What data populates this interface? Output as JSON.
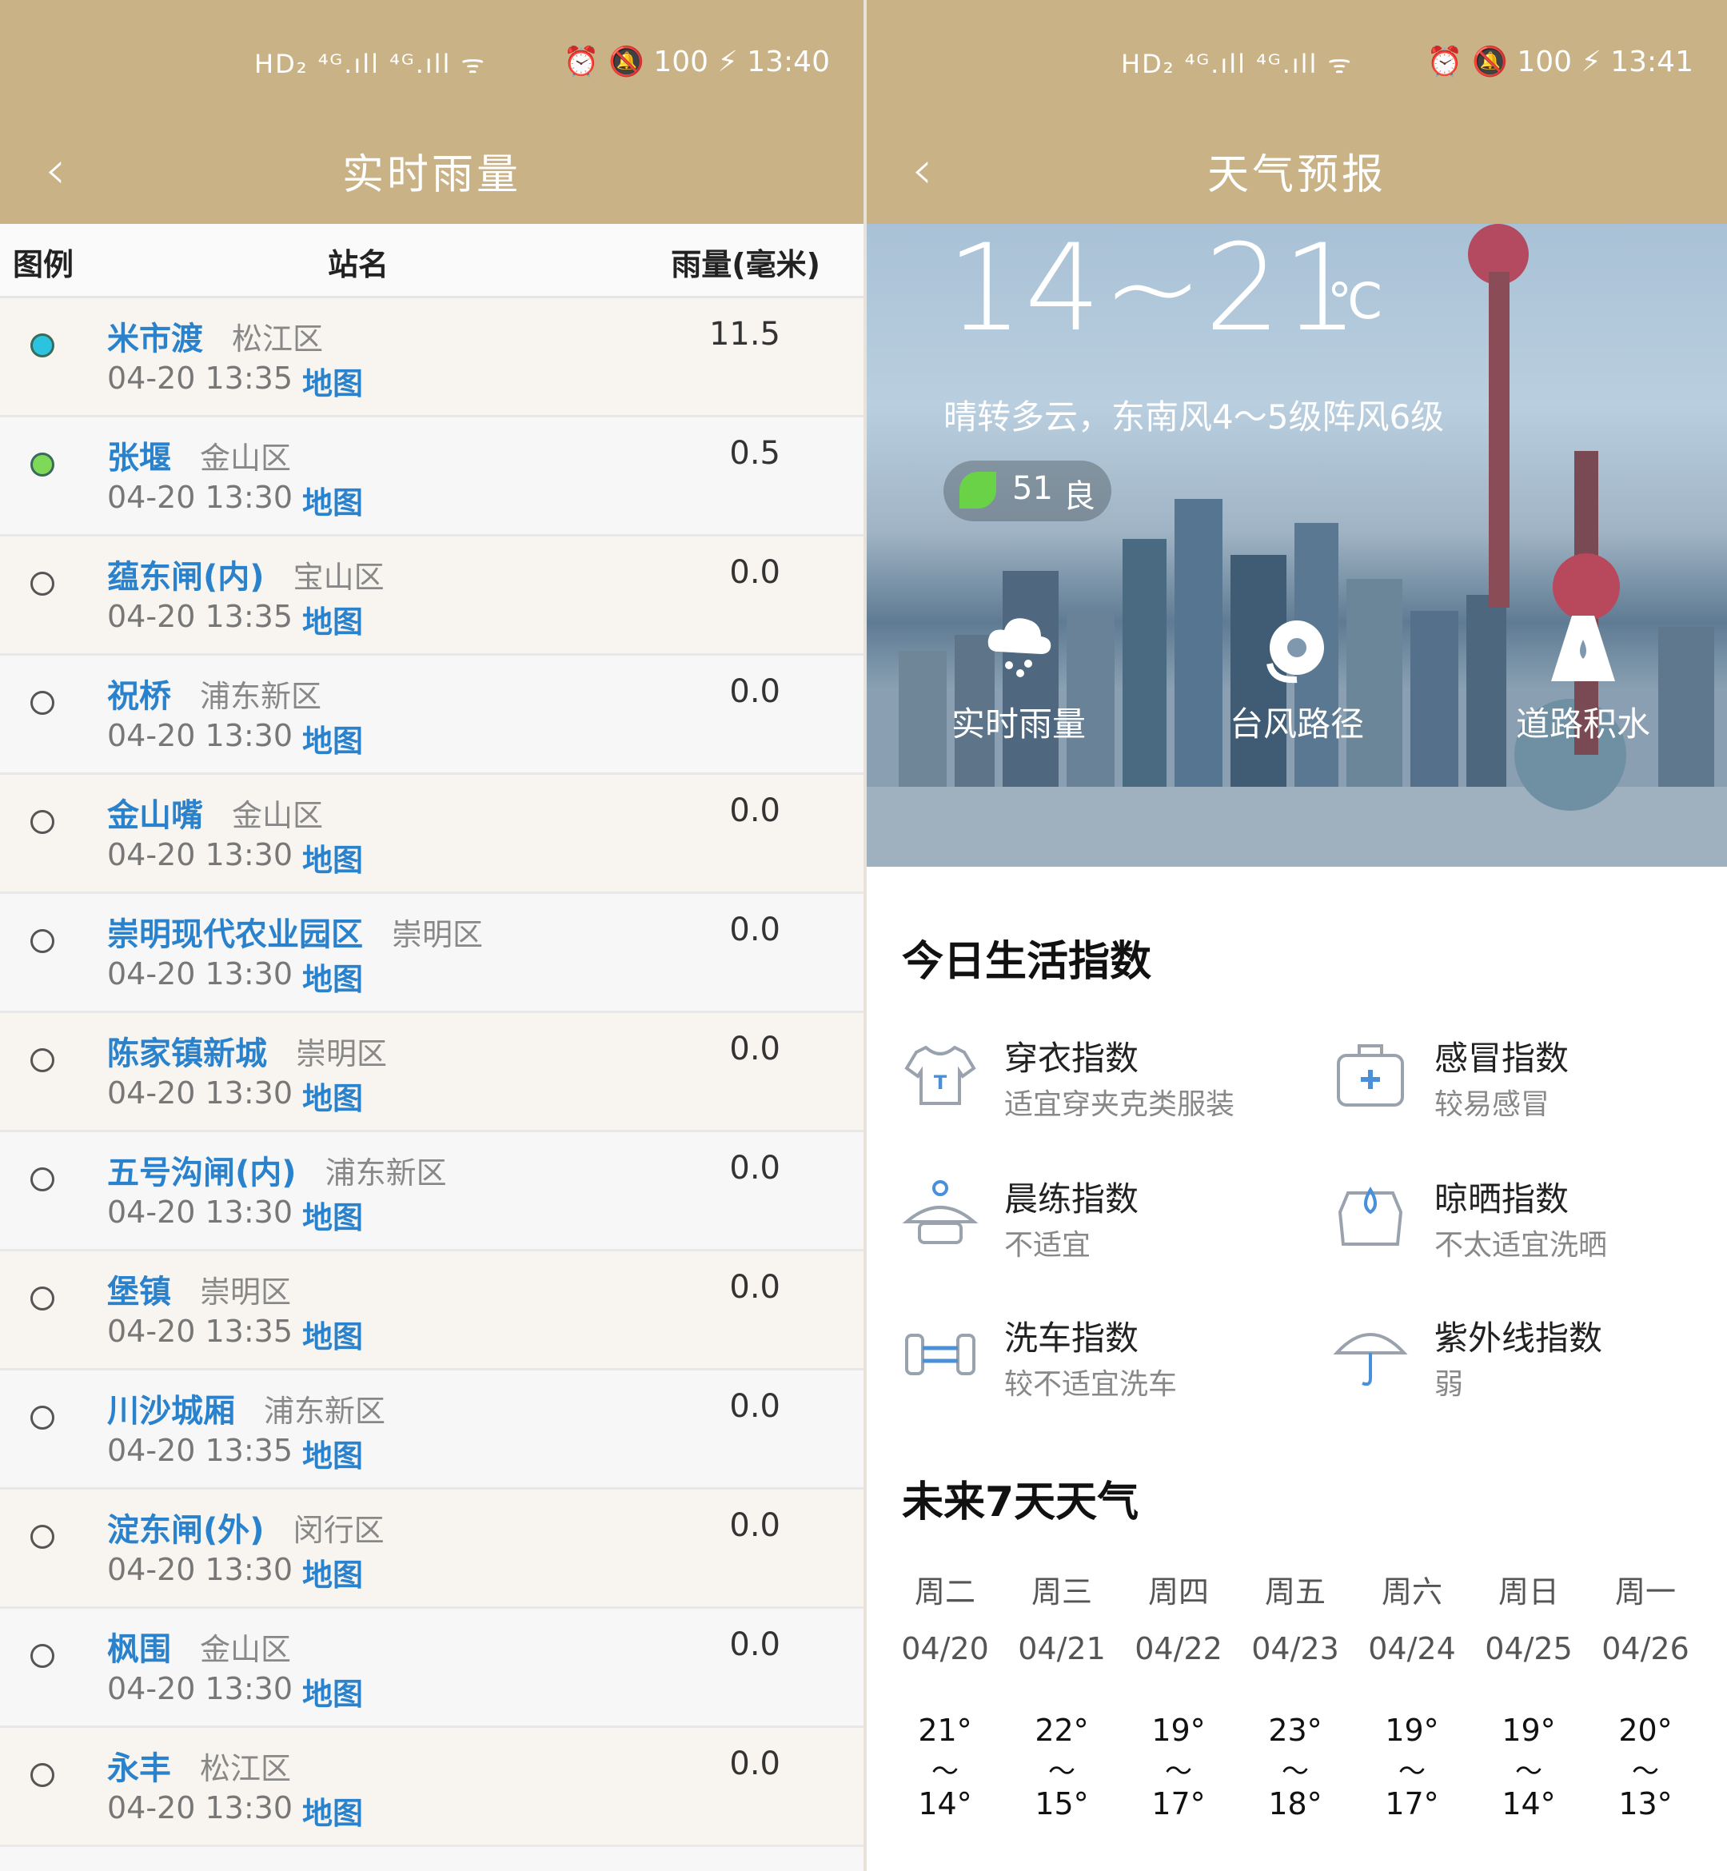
{
  "left": {
    "status": {
      "left": "HD₂ ⁴ᴳ.ıll ⁴ᴳ.ıll ᯤ",
      "right": "⏰ 🔕 100 ⚡ 13:40"
    },
    "title": "实时雨量",
    "table_headers": {
      "legend": "图例",
      "station": "站名",
      "rain": "雨量(毫米)"
    },
    "map_label": "地图",
    "rows": [
      {
        "name": "米市渡",
        "district": "松江区",
        "time": "04-20 13:35",
        "rain": "11.5",
        "dot": "#2bc3e0"
      },
      {
        "name": "张堰",
        "district": "金山区",
        "time": "04-20 13:30",
        "rain": "0.5",
        "dot": "#7ed957"
      },
      {
        "name": "蕴东闸(内)",
        "district": "宝山区",
        "time": "04-20 13:35",
        "rain": "0.0",
        "dot": ""
      },
      {
        "name": "祝桥",
        "district": "浦东新区",
        "time": "04-20 13:30",
        "rain": "0.0",
        "dot": ""
      },
      {
        "name": "金山嘴",
        "district": "金山区",
        "time": "04-20 13:30",
        "rain": "0.0",
        "dot": ""
      },
      {
        "name": "崇明现代农业园区",
        "district": "崇明区",
        "time": "04-20 13:30",
        "rain": "0.0",
        "dot": ""
      },
      {
        "name": "陈家镇新城",
        "district": "崇明区",
        "time": "04-20 13:30",
        "rain": "0.0",
        "dot": ""
      },
      {
        "name": "五号沟闸(内)",
        "district": "浦东新区",
        "time": "04-20 13:30",
        "rain": "0.0",
        "dot": ""
      },
      {
        "name": "堡镇",
        "district": "崇明区",
        "time": "04-20 13:35",
        "rain": "0.0",
        "dot": ""
      },
      {
        "name": "川沙城厢",
        "district": "浦东新区",
        "time": "04-20 13:35",
        "rain": "0.0",
        "dot": ""
      },
      {
        "name": "淀东闸(外)",
        "district": "闵行区",
        "time": "04-20 13:30",
        "rain": "0.0",
        "dot": ""
      },
      {
        "name": "枫围",
        "district": "金山区",
        "time": "04-20 13:30",
        "rain": "0.0",
        "dot": ""
      },
      {
        "name": "永丰",
        "district": "松江区",
        "time": "04-20 13:30",
        "rain": "0.0",
        "dot": ""
      }
    ]
  },
  "right": {
    "status": {
      "left": "HD₂ ⁴ᴳ.ıll ⁴ᴳ.ıll ᯤ",
      "right": "⏰ 🔕 100 ⚡ 13:41"
    },
    "title": "天气预报",
    "temp_range": "14~21",
    "temp_unit": "℃",
    "description": "晴转多云，东南风4～5级阵风6级",
    "aqi": {
      "value": "51",
      "level": "良"
    },
    "shortcuts": [
      "实时雨量",
      "台风路径",
      "道路积水"
    ],
    "life_title": "今日生活指数",
    "life_index": [
      {
        "title": "穿衣指数",
        "sub": "适宜穿夹克类服装",
        "icon": "shirt-icon"
      },
      {
        "title": "感冒指数",
        "sub": "较易感冒",
        "icon": "medkit-icon"
      },
      {
        "title": "晨练指数",
        "sub": "不适宜",
        "icon": "exercise-icon"
      },
      {
        "title": "晾晒指数",
        "sub": "不太适宜洗晒",
        "icon": "laundry-icon"
      },
      {
        "title": "洗车指数",
        "sub": "较不适宜洗车",
        "icon": "car-wash-icon"
      },
      {
        "title": "紫外线指数",
        "sub": "弱",
        "icon": "umbrella-icon"
      }
    ],
    "forecast_title": "未来7天天气",
    "forecast": [
      {
        "weekday": "周二",
        "date": "04/20",
        "high": "21°",
        "sep": "～",
        "low": "14°"
      },
      {
        "weekday": "周三",
        "date": "04/21",
        "high": "22°",
        "sep": "～",
        "low": "15°"
      },
      {
        "weekday": "周四",
        "date": "04/22",
        "high": "19°",
        "sep": "～",
        "low": "17°"
      },
      {
        "weekday": "周五",
        "date": "04/23",
        "high": "23°",
        "sep": "～",
        "low": "18°"
      },
      {
        "weekday": "周六",
        "date": "04/24",
        "high": "19°",
        "sep": "～",
        "low": "17°"
      },
      {
        "weekday": "周日",
        "date": "04/25",
        "high": "19°",
        "sep": "～",
        "low": "14°"
      },
      {
        "weekday": "周一",
        "date": "04/26",
        "high": "20°",
        "sep": "～",
        "low": "13°"
      }
    ]
  }
}
